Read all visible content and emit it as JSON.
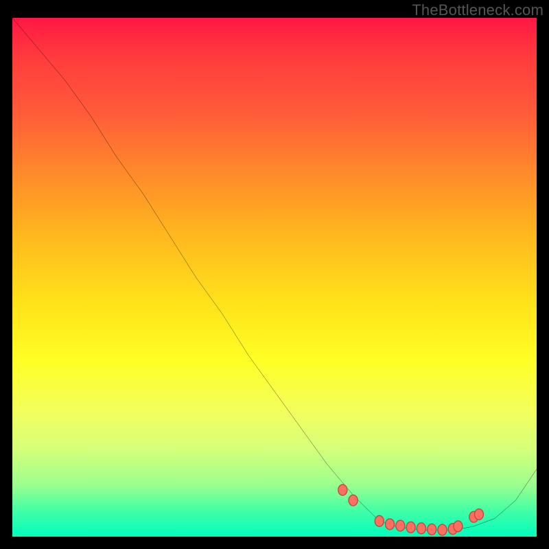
{
  "watermark": "TheBottleneck.com",
  "chart_data": {
    "type": "line",
    "title": "",
    "xlabel": "",
    "ylabel": "",
    "xlim": [
      0,
      100
    ],
    "ylim": [
      0,
      100
    ],
    "grid": false,
    "legend": false,
    "colors": {
      "gradient_top": "#ff1744",
      "gradient_bottom": "#00fdbd",
      "line": "#000000",
      "marker_fill": "#ff6f61",
      "marker_edge": "#c1483d"
    },
    "series": [
      {
        "name": "curve",
        "x": [
          0,
          5,
          10,
          15,
          20,
          25,
          30,
          35,
          40,
          45,
          50,
          55,
          60,
          65,
          68,
          70,
          73,
          76,
          80,
          84,
          88,
          92,
          96,
          100
        ],
        "y": [
          100,
          94,
          88,
          81,
          73,
          66,
          58,
          50,
          43,
          35,
          28,
          21,
          14,
          8,
          5,
          3,
          2,
          1.5,
          1.2,
          1.2,
          2,
          3.5,
          7,
          13
        ]
      }
    ],
    "markers": {
      "x": [
        63,
        65,
        70,
        72,
        74,
        76,
        78,
        80,
        82,
        84,
        85,
        88,
        89
      ],
      "y": [
        9,
        7,
        3,
        2.4,
        2.1,
        1.8,
        1.6,
        1.4,
        1.3,
        1.5,
        2.0,
        3.8,
        4.3
      ]
    }
  }
}
